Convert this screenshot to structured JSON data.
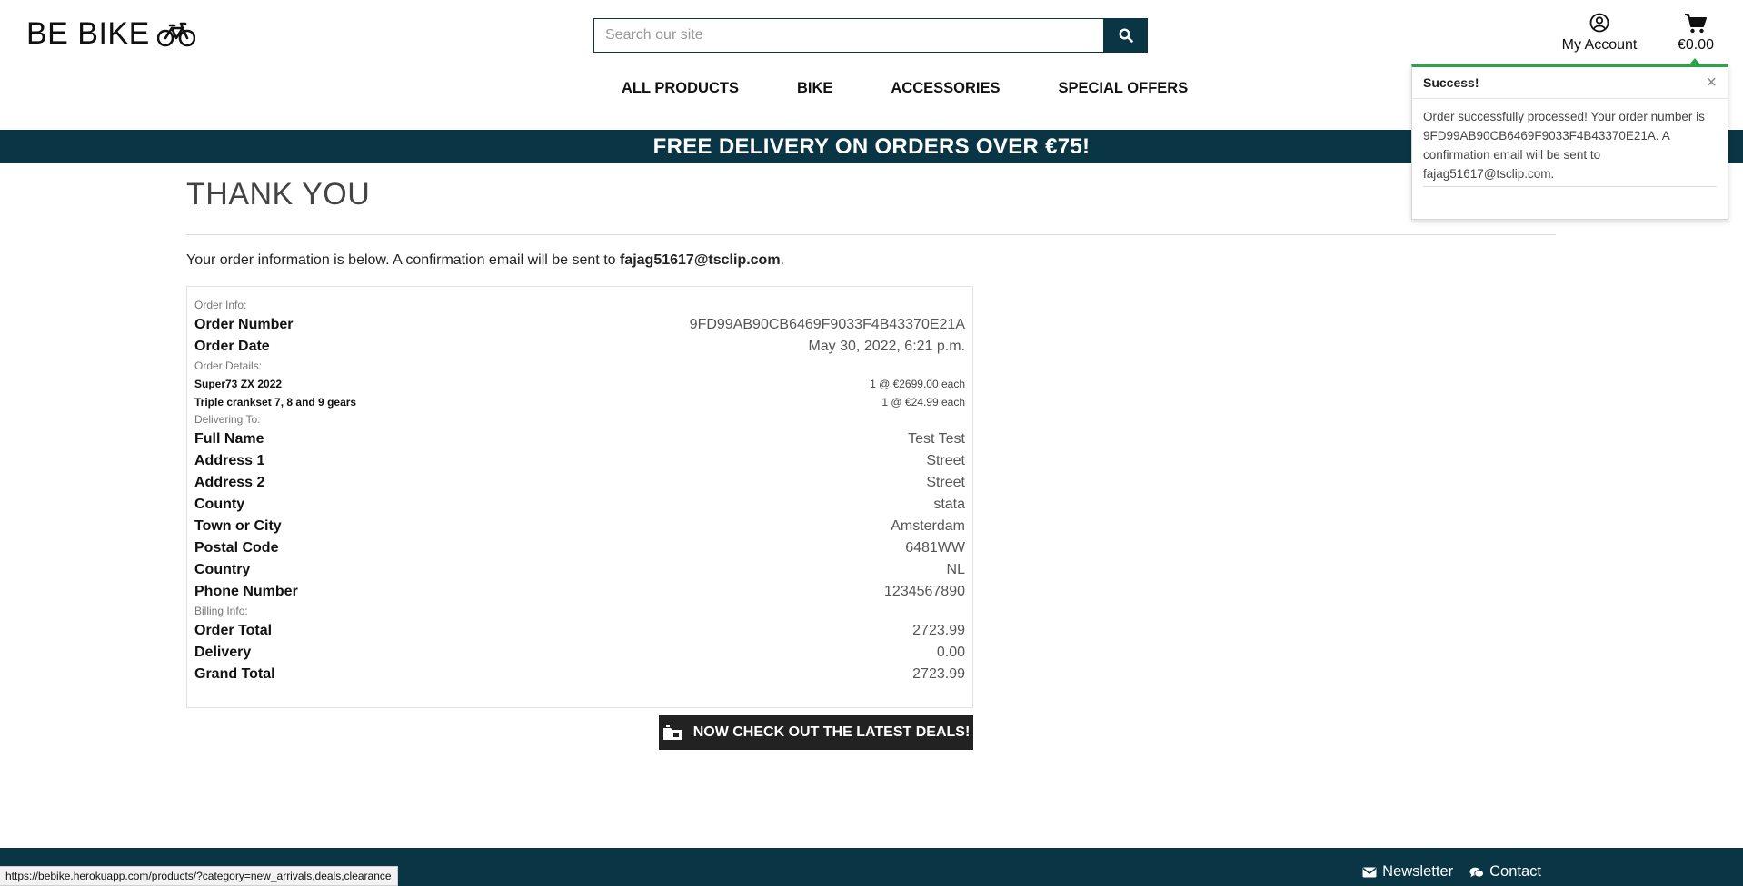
{
  "header": {
    "brand": "BE BIKE",
    "search_placeholder": "Search our site",
    "account_label": "My Account",
    "cart_total": "€0.00"
  },
  "nav": {
    "items": [
      "ALL PRODUCTS",
      "BIKE",
      "ACCESSORIES",
      "SPECIAL OFFERS"
    ]
  },
  "banner": {
    "text": "FREE DELIVERY ON ORDERS OVER €75!"
  },
  "main": {
    "title": "THANK YOU",
    "intro_prefix": "Your order information is below. A confirmation email will be sent to ",
    "email": "fajag51617@tsclip.com",
    "intro_suffix": "."
  },
  "order": {
    "info_heading": "Order Info:",
    "order_number_label": "Order Number",
    "order_number": "9FD99AB90CB6469F9033F4B43370E21A",
    "order_date_label": "Order Date",
    "order_date": "May 30, 2022, 6:21 p.m.",
    "details_heading": "Order Details:",
    "items": [
      {
        "name": "Super73 ZX 2022",
        "qty_price": "1 @ €2699.00 each"
      },
      {
        "name": "Triple crankset 7, 8 and 9 gears",
        "qty_price": "1 @ €24.99 each"
      }
    ],
    "delivery_heading": "Delivering To:",
    "delivery": [
      {
        "label": "Full Name",
        "value": "Test Test"
      },
      {
        "label": "Address 1",
        "value": "Street"
      },
      {
        "label": "Address 2",
        "value": "Street"
      },
      {
        "label": "County",
        "value": "stata"
      },
      {
        "label": "Town or City",
        "value": "Amsterdam"
      },
      {
        "label": "Postal Code",
        "value": "6481WW"
      },
      {
        "label": "Country",
        "value": "NL"
      },
      {
        "label": "Phone Number",
        "value": "1234567890"
      }
    ],
    "billing_heading": "Billing Info:",
    "billing": [
      {
        "label": "Order Total",
        "value": "2723.99"
      },
      {
        "label": "Delivery",
        "value": "0.00"
      },
      {
        "label": "Grand Total",
        "value": "2723.99"
      }
    ]
  },
  "deals_button": "NOW CHECK OUT THE LATEST DEALS!",
  "toast": {
    "title": "Success!",
    "close": "×",
    "message": "Order successfully processed! Your order number is 9FD99AB90CB6469F9033F4B43370E21A. A confirmation email will be sent to fajag51617@tsclip.com.",
    "accent_color": "#28a745"
  },
  "footer": {
    "newsletter": "Newsletter",
    "contact": "Contact"
  },
  "status_url": "https://bebike.herokuapp.com/products/?category=new_arrivals,deals,clearance",
  "colors": {
    "brand_dark": "#0a3545",
    "button_dark": "#222222"
  },
  "icons": [
    "bicycle-icon",
    "search-icon",
    "user-circle-icon",
    "cart-icon",
    "close-icon",
    "tag-icon",
    "envelope-icon",
    "chat-icon"
  ]
}
